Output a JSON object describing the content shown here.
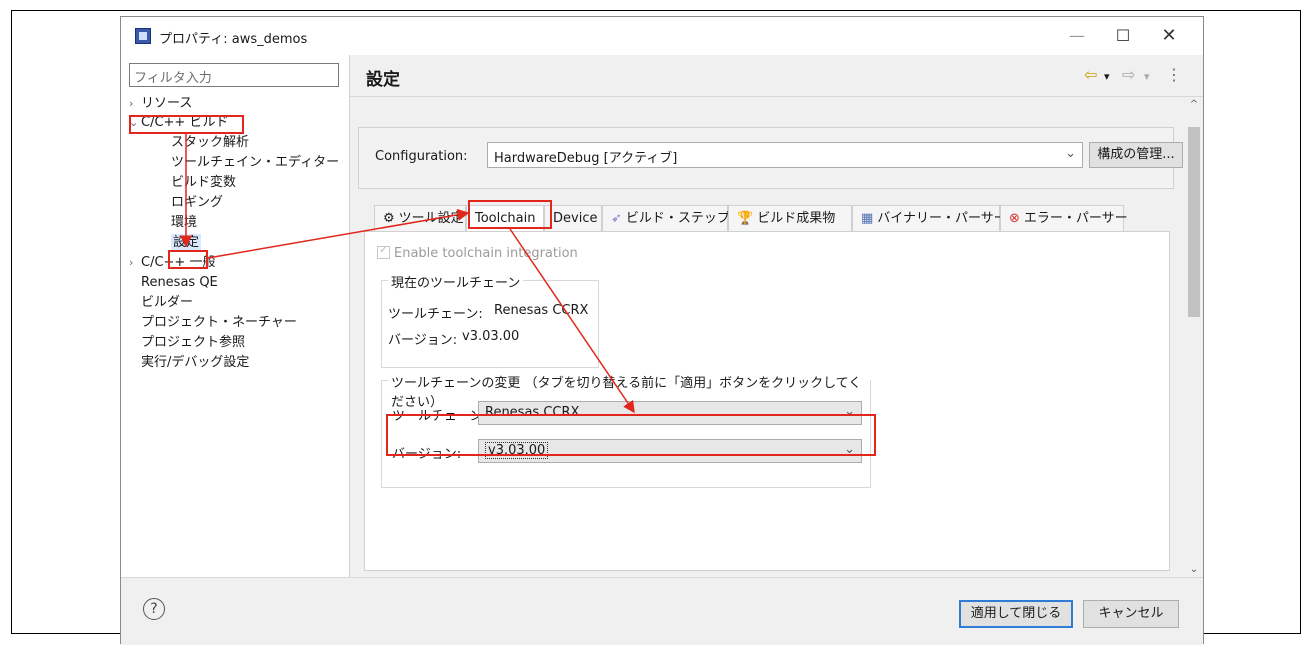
{
  "window": {
    "title": "プロパティ: aws_demos",
    "controls": {
      "minimize": "—",
      "maximize": "☐",
      "close": "✕"
    }
  },
  "left_pane": {
    "filter_placeholder": "フィルタ入力",
    "tree": [
      {
        "label": "リソース",
        "chevron": "›",
        "level": 0
      },
      {
        "label": "C/C++ ビルド",
        "chevron": "⌄",
        "level": 0
      },
      {
        "label": "スタック解析",
        "level": 1
      },
      {
        "label": "ツールチェイン・エディター",
        "level": 1
      },
      {
        "label": "ビルド変数",
        "level": 1
      },
      {
        "label": "ロギング",
        "level": 1
      },
      {
        "label": "環境",
        "level": 1
      },
      {
        "label": "設定",
        "level": 1,
        "selected": true
      },
      {
        "label": "C/C++ 一般",
        "chevron": "›",
        "level": 0
      },
      {
        "label": "Renesas QE",
        "level": 0
      },
      {
        "label": "ビルダー",
        "level": 0
      },
      {
        "label": "プロジェクト・ネーチャー",
        "level": 0
      },
      {
        "label": "プロジェクト参照",
        "level": 0
      },
      {
        "label": "実行/デバッグ設定",
        "level": 0
      }
    ]
  },
  "right_pane": {
    "title": "設定",
    "nav": {
      "back": "⇦",
      "dropdown1": "▾",
      "forward": "⇨",
      "dropdown2": "▾",
      "menu": "⋮"
    },
    "configuration": {
      "label": "Configuration:",
      "value": "HardwareDebug [アクティブ]",
      "manage_button": "構成の管理..."
    },
    "tabs": [
      {
        "label": "ツール設定",
        "icon": "⚙"
      },
      {
        "label": "Toolchain",
        "icon": "",
        "active": true
      },
      {
        "label": "Device",
        "icon": ""
      },
      {
        "label": "ビルド・ステップ",
        "icon": "➶"
      },
      {
        "label": "ビルド成果物",
        "icon": "🏆"
      },
      {
        "label": "バイナリー・パーサー",
        "icon": "▦"
      },
      {
        "label": "エラー・パーサー",
        "icon": "⊗"
      }
    ],
    "toolchain_tab": {
      "enable_checkbox": "Enable toolchain integration",
      "current_group": {
        "legend": "現在のツールチェーン",
        "toolchain_label": "ツールチェーン:",
        "toolchain_value": "Renesas CCRX",
        "version_label": "バージョン:",
        "version_value": "v3.03.00"
      },
      "change_group": {
        "legend": "ツールチェーンの変更 （タブを切り替える前に「適用」ボタンをクリックしてください）",
        "toolchain_label": "ツールチェーン:",
        "toolchain_value": "Renesas CCRX",
        "version_label": "バージョン:",
        "version_value": "v3.03.00"
      }
    }
  },
  "bottom_bar": {
    "help_icon": "?",
    "apply_close": "適用して閉じる",
    "cancel": "キャンセル"
  },
  "colors": {
    "annotation": "#e1261c",
    "primary_border": "#2f7bd6"
  }
}
